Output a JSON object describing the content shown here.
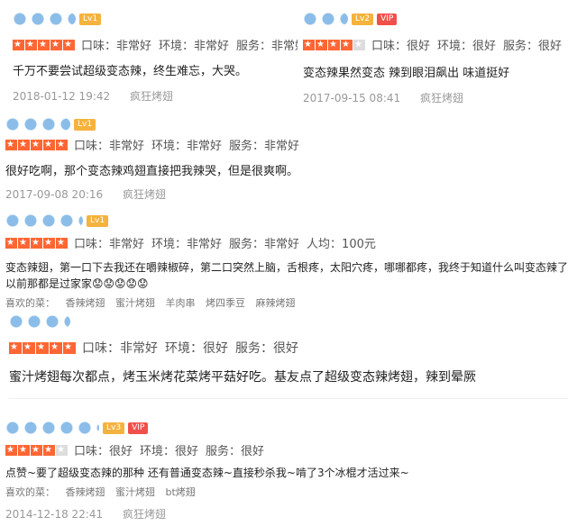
{
  "reviews": [
    {
      "level": "Lv1",
      "vip": "",
      "stars": 5,
      "ratings": [
        "口味：非常好",
        "环境：非常好",
        "服务：非常好"
      ],
      "text": "千万不要尝试超级变态辣，终生难忘，大哭。",
      "date": "2018-01-12 19:42",
      "shop": "疯狂烤翅"
    },
    {
      "level": "Lv2",
      "vip": "VIP",
      "stars": 4,
      "ratings": [
        "口味：很好",
        "环境：很好",
        "服务：很好"
      ],
      "text": "变态辣果然变态 辣到眼泪飙出 味道挺好",
      "date": "2017-09-15 08:41",
      "shop": "疯狂烤翅"
    },
    {
      "level": "Lv1",
      "vip": "",
      "stars": 5,
      "ratings": [
        "口味：非常好",
        "环境：非常好",
        "服务：非常好"
      ],
      "text": "很好吃啊，那个变态辣鸡翅直接把我辣哭，但是很爽啊。",
      "date": "2017-09-08 20:16",
      "shop": "疯狂烤翅"
    },
    {
      "level": "Lv1",
      "vip": "",
      "stars": 5,
      "ratings": [
        "口味：非常好",
        "环境：非常好",
        "服务：非常好",
        "人均：100元"
      ],
      "text_lines": [
        "变态辣翅，第一口下去我还在嚼辣椒碎，第二口突然上脑，舌根疼，太阳穴疼，哪哪都疼，我终于知道什么叫变态辣了",
        "以前那都是过家家😟😟😟😟😟"
      ],
      "fav_label": "喜欢的菜：",
      "fav_items": [
        "香辣烤翅",
        "蜜汁烤翅",
        "羊肉串",
        "烤四季豆",
        "麻辣烤翅"
      ]
    },
    {
      "level": "",
      "vip": "",
      "stars": 5,
      "ratings": [
        "口味：非常好",
        "环境：很好",
        "服务：很好"
      ],
      "text": "蜜汁烤翅每次都点，烤玉米烤花菜烤平菇好吃。基友点了超级变态辣烤翅，辣到晕厥"
    },
    {
      "level": "Lv3",
      "vip": "VIP",
      "stars": 4,
      "ratings": [
        "口味：很好",
        "环境：很好",
        "服务：很好"
      ],
      "text": "点赞~要了超级变态辣的那种 还有普通变态辣~直接秒杀我~啃了3个冰棍才活过来~",
      "fav_label": "喜欢的菜：",
      "fav_items": [
        "香辣烤翅",
        "蜜汁烤翅",
        "bt烤翅"
      ],
      "date": "2014-12-18 22:41",
      "shop": "疯狂烤翅"
    }
  ]
}
